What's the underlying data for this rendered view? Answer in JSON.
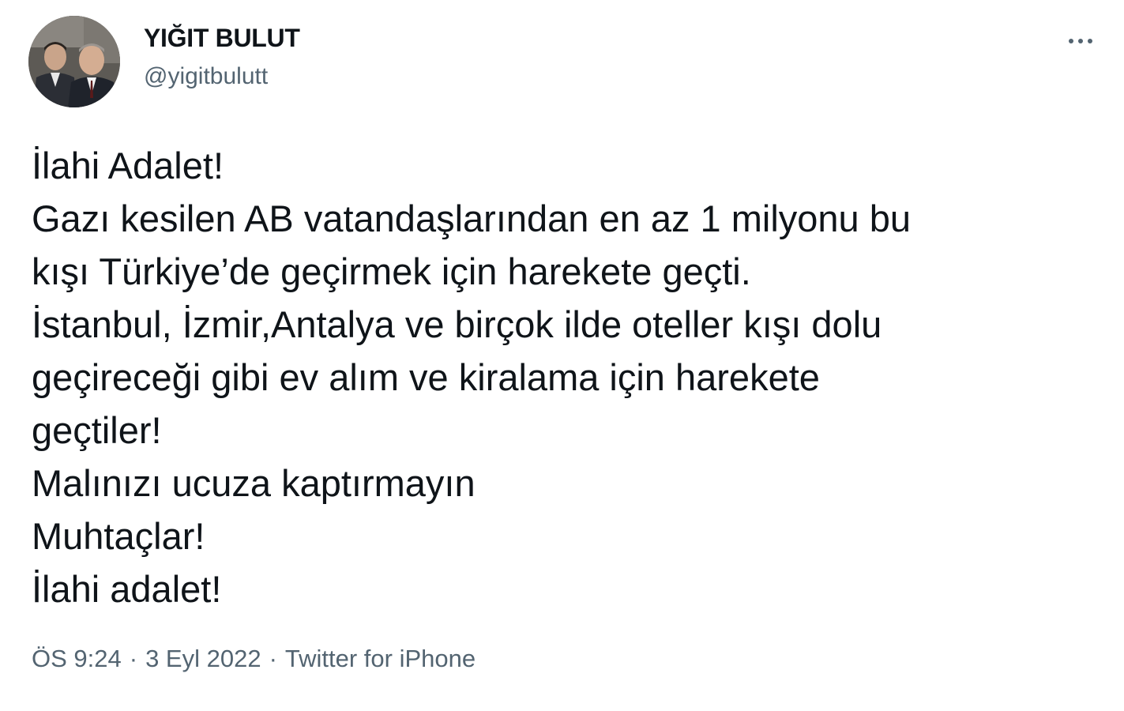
{
  "author": {
    "display_name": "YIĞIT BULUT",
    "handle": "@yigitbulutt"
  },
  "tweet": {
    "lines": [
      "İlahi Adalet!",
      "Gazı kesilen AB vatandaşlarından en az 1 milyonu bu",
      "kışı Türkiye’de geçirmek için harekete geçti.",
      "İstanbul, İzmir,Antalya ve birçok ilde oteller kışı dolu",
      "geçireceği gibi ev alım ve kiralama için harekete",
      "geçtiler!",
      "Malınızı ucuza kaptırmayın",
      "Muhtaçlar!",
      "İlahi adalet!"
    ]
  },
  "meta": {
    "time": "ÖS 9:24",
    "separator": "·",
    "date": "3 Eyl 2022",
    "source": "Twitter for iPhone"
  },
  "icons": {
    "more": "more-options-icon",
    "avatar": "profile-photo"
  }
}
